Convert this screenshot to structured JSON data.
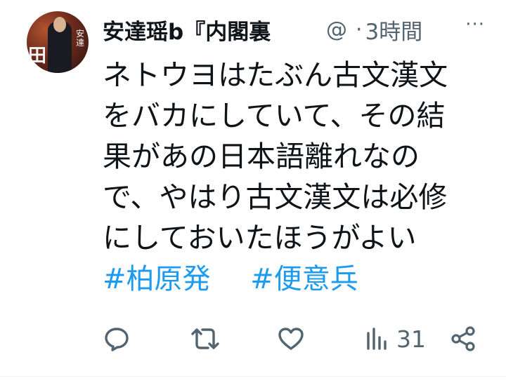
{
  "tweet": {
    "author_name": "安達瑶b『内閣裏",
    "handle": "@",
    "separator": "·",
    "time": "3時間",
    "more_label": "···",
    "avatar": {
      "side_text": "田",
      "vertical_text": "安達"
    },
    "body_lines": [
      "ネトウヨはたぶん古文漢文",
      "をバカにしていて、その結",
      "果があの日本語離れなの",
      "で、やはり古文漢文は必修",
      "にしておいたほうがよい"
    ],
    "hashtags": [
      "#柏原発",
      "#便意兵"
    ]
  },
  "actions": {
    "reply_icon": "reply-icon",
    "retweet_icon": "retweet-icon",
    "like_icon": "like-icon",
    "views_icon": "views-icon",
    "views_count": "31",
    "share_icon": "share-icon"
  },
  "colors": {
    "link": "#1d9bf0",
    "muted": "#536471",
    "text": "#0f1419"
  }
}
